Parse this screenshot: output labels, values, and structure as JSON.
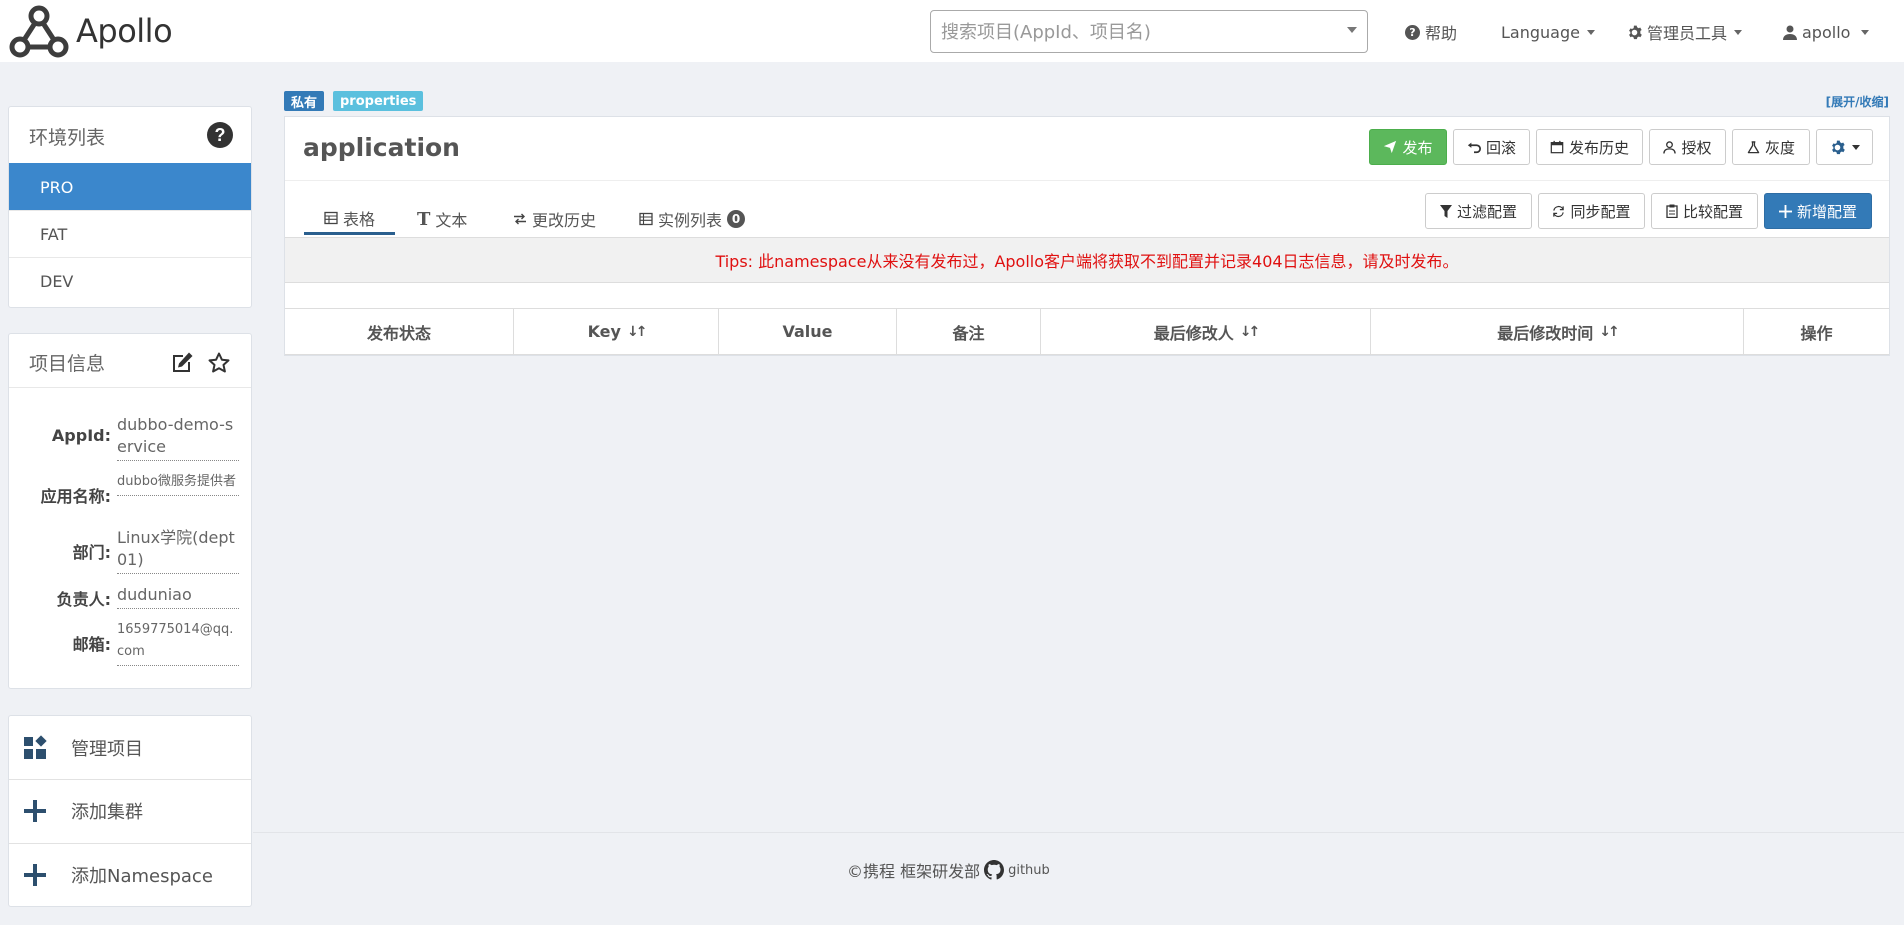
{
  "header": {
    "brand": "Apollo",
    "search_placeholder": "搜索项目(AppId、项目名)",
    "help": "帮助",
    "language": "Language",
    "admin_tools": "管理员工具",
    "user": "apollo"
  },
  "sidebar": {
    "env_title": "环境列表",
    "envs": [
      {
        "label": "PRO",
        "active": true
      },
      {
        "label": "FAT",
        "active": false
      },
      {
        "label": "DEV",
        "active": false
      }
    ],
    "info_title": "项目信息",
    "info": [
      {
        "label": "AppId:",
        "value": "dubbo-demo-service"
      },
      {
        "label": "应用名称:",
        "value": "dubbo微服务提供者"
      },
      {
        "label": "部门:",
        "value": "Linux学院(dept01)"
      },
      {
        "label": "负责人:",
        "value": "duduniao"
      },
      {
        "label": "邮箱:",
        "value": "1659775014@qq.com"
      }
    ],
    "actions": [
      {
        "label": "管理项目"
      },
      {
        "label": "添加集群"
      },
      {
        "label": "添加Namespace"
      }
    ]
  },
  "namespace": {
    "badge_private": "私有",
    "badge_format": "properties",
    "expand": "[展开/收缩]",
    "title": "application",
    "buttons": {
      "publish": "发布",
      "rollback": "回滚",
      "history": "发布历史",
      "grant": "授权",
      "gray": "灰度"
    },
    "tabs": {
      "table": "表格",
      "text": "文本",
      "change_history": "更改历史",
      "instances": "实例列表",
      "instances_count": "0"
    },
    "tools": {
      "filter": "过滤配置",
      "sync": "同步配置",
      "compare": "比较配置",
      "add": "新增配置"
    },
    "tips": "Tips: 此namespace从来没有发布过，Apollo客户端将获取不到配置并记录404日志信息，请及时发布。",
    "columns": [
      "发布状态",
      "Key",
      "Value",
      "备注",
      "最后修改人",
      "最后修改时间",
      "操作"
    ]
  },
  "footer": {
    "company": "©携程 框架研发部",
    "github": "github"
  },
  "colors": {
    "primary": "#337ab7",
    "success": "#5cb85c",
    "info": "#5bc0de",
    "env_active": "#3b87cc",
    "tips_red": "#e01010",
    "page_bg": "#eff1f5"
  }
}
